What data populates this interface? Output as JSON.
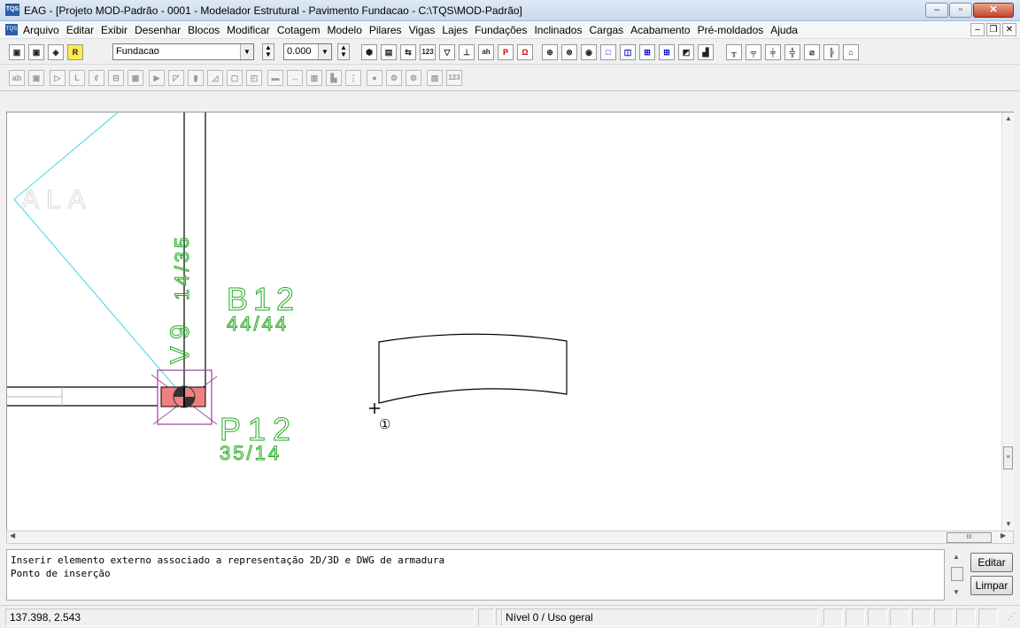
{
  "window": {
    "app_icon": "TQS",
    "title": "EAG - [Projeto MOD-Padrão - 0001 - Modelador Estrutural - Pavimento Fundacao - C:\\TQS\\MOD-Padrão]"
  },
  "menu": {
    "items": [
      "Arquivo",
      "Editar",
      "Exibir",
      "Desenhar",
      "Blocos",
      "Modificar",
      "Cotagem",
      "Modelo",
      "Pilares",
      "Vigas",
      "Lajes",
      "Fundações",
      "Inclinados",
      "Cargas",
      "Acabamento",
      "Pré-moldados",
      "Ajuda"
    ]
  },
  "toolbar": {
    "floor_value": "Fundacao",
    "level_value": "0.000",
    "btn_123": "123",
    "btn_ah": "ah"
  },
  "drawing": {
    "label_ala": "ALA",
    "beam_v9": "V9",
    "beam_v9_dims": "14/35",
    "block_name": "B12",
    "block_dims": "44/44",
    "pillar_name": "P12",
    "pillar_dims": "35/14",
    "insert_marker": "①"
  },
  "command": {
    "line1": "Inserir elemento externo associado a representação 2D/3D e DWG de armadura",
    "line2": "Ponto de inserção",
    "edit_button": "Editar",
    "clear_button": "Limpar"
  },
  "status": {
    "coordinates": "137.398,    2.543",
    "layer": "Nível 0 / Uso geral"
  },
  "colors": {
    "drawing_green": "#22aa22",
    "ala_line": "#3fd8e8",
    "pillar_fill": "#f08080",
    "block_outline": "#a03ca0"
  }
}
